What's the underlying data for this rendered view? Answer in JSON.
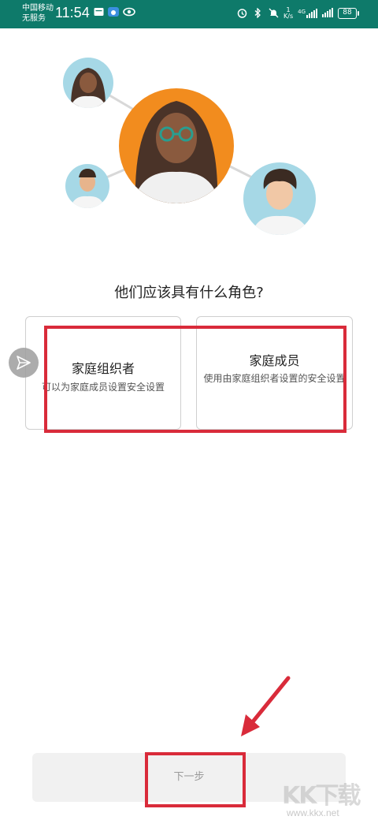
{
  "status_bar": {
    "carrier_line1": "中国移动",
    "carrier_line2": "无服务",
    "time": "11:54",
    "net_speed_value": "1",
    "net_speed_unit": "K/s",
    "signal_label": "4G",
    "battery": "88",
    "icons": [
      "notification-icon",
      "weather-icon",
      "eye-icon",
      "alarm-icon",
      "bluetooth-icon",
      "mute-icon",
      "signal-icon",
      "battery-icon"
    ]
  },
  "illustration": {
    "accent_color": "#f28c1e",
    "bubble_color": "#a6d8e6"
  },
  "question": "他们应该具有什么角色?",
  "roles": [
    {
      "title": "家庭组织者",
      "description": "可以为家庭成员设置安全设置"
    },
    {
      "title": "家庭成员",
      "description": "使用由家庭组织者设置的安全设置"
    }
  ],
  "next_button": {
    "label": "下一步"
  },
  "watermark": {
    "logo": "KK下载",
    "url": "www.kkx.net"
  },
  "colors": {
    "status_bar": "#0e7a6a",
    "highlight": "#d92b3a"
  }
}
